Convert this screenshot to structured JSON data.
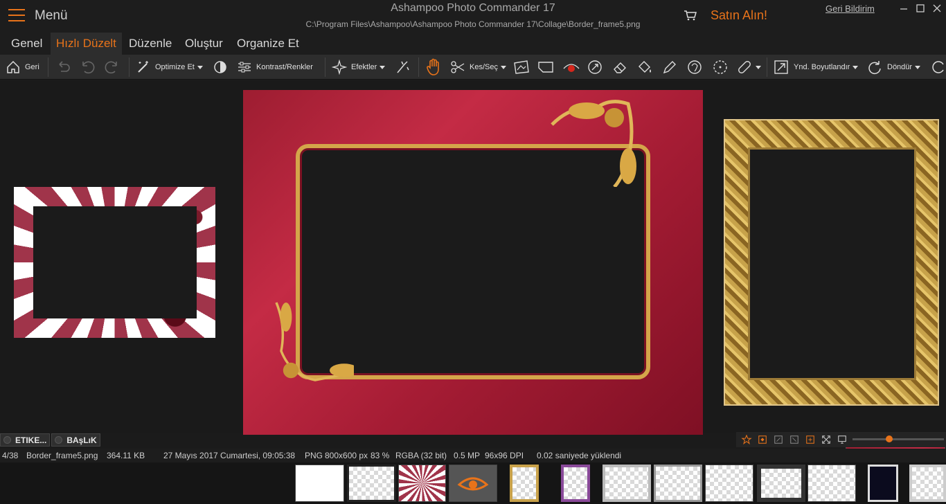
{
  "app": {
    "menu_label": "Menü",
    "title": "Ashampoo Photo Commander 17",
    "file_path": "C:\\Program Files\\Ashampoo\\Ashampoo Photo Commander 17\\Collage\\Border_frame5.png",
    "buy_label": "Satın Alın!",
    "feedback_label": "Geri Bildirim",
    "accent_color": "#e8731a"
  },
  "tabs": [
    {
      "label": "Genel",
      "active": false
    },
    {
      "label": "Hızlı Düzelt",
      "active": true
    },
    {
      "label": "Düzenle",
      "active": false
    },
    {
      "label": "Oluştur",
      "active": false
    },
    {
      "label": "Organize Et",
      "active": false
    }
  ],
  "toolbar": {
    "back_label": "Geri",
    "optimize_label": "Optimize Et",
    "contrast_label": "Kontrast/Renkler",
    "effects_label": "Efektler",
    "cut_label": "Kes/Seç",
    "resize_label": "Ynd. Boyutlandır",
    "rotate_label": "Döndür"
  },
  "tags": {
    "label_chip": "ETIKE...",
    "title_chip": "BAşLıK"
  },
  "view": {
    "zoom_fraction": 0.4
  },
  "status": {
    "index": "4/38",
    "filename": "Border_frame5.png",
    "filesize": "364.11 KB",
    "date": "27 Mayıs 2017 Cumartesi, 09:05:38",
    "format": "PNG",
    "dimensions": "800x600 px",
    "zoom": "83 %",
    "color_mode": "RGBA (32 bit)",
    "megapixels": "0.5 MP",
    "dpi": "96x96 DPI",
    "load_time": "0.02 saniyede yüklendi"
  }
}
